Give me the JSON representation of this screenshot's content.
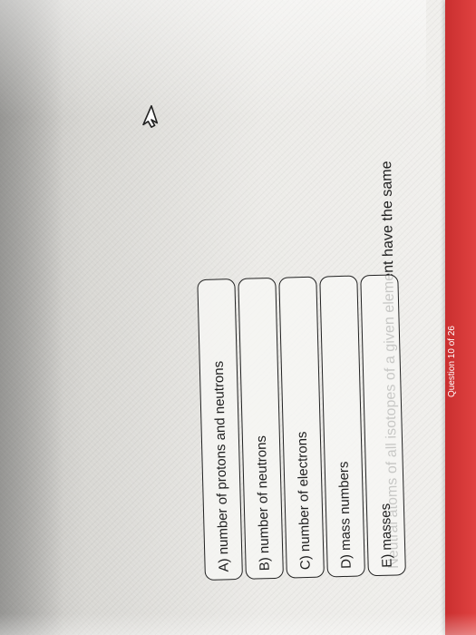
{
  "header": {
    "counter": "Question 10 of 26",
    "bar_color": "#d93a39"
  },
  "question": {
    "text": "Neutral atoms of all isotopes of a given element have the same"
  },
  "choices": [
    {
      "label": "A) number of protons and neutrons"
    },
    {
      "label": "B) number of neutrons"
    },
    {
      "label": "C) number of electrons"
    },
    {
      "label": "D) mass numbers"
    },
    {
      "label": "E) masses"
    }
  ],
  "icons": {
    "cursor": "cursor-arrow-icon"
  }
}
